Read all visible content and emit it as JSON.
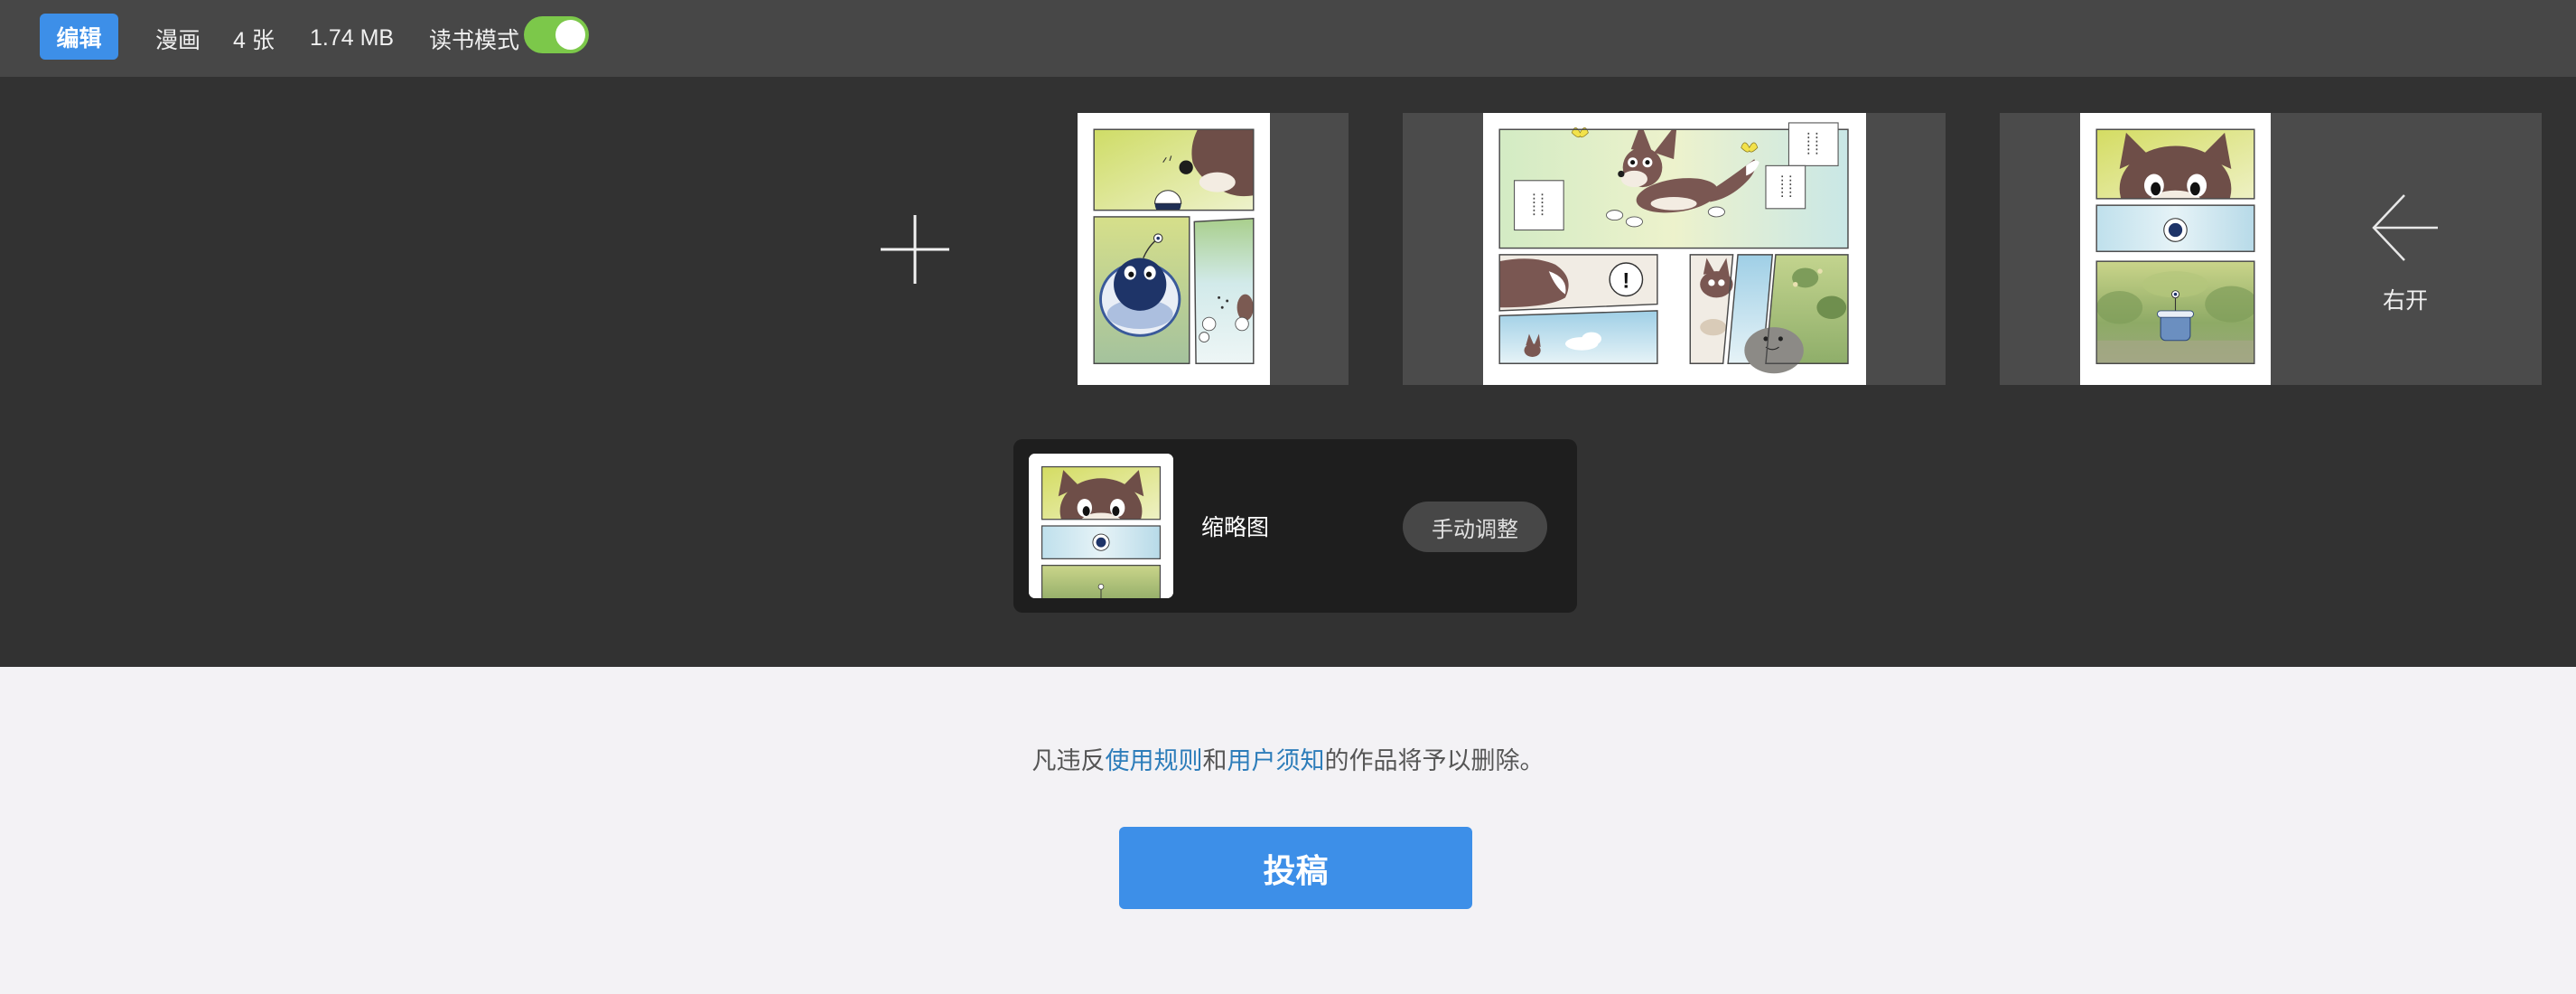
{
  "toolbar": {
    "edit_label": "编辑",
    "category": "漫画",
    "count": "4 张",
    "size": "1.74 MB",
    "reading_mode_label": "读书模式",
    "reading_mode_on": true
  },
  "icons": {
    "add": "plus-icon",
    "direction": "arrow-left-icon"
  },
  "direction": {
    "label": "右开"
  },
  "pages": [
    {
      "kind": "comic-page"
    },
    {
      "kind": "comic-spread",
      "bubble": "!"
    },
    {
      "kind": "comic-page"
    }
  ],
  "thumbnail": {
    "label": "缩略图",
    "adjust_button": "手动调整"
  },
  "notice": {
    "prefix": "凡违反",
    "link1": "使用规则",
    "middle": "和",
    "link2": "用户须知",
    "suffix": "的作品将予以删除。"
  },
  "submit_label": "投稿",
  "colors": {
    "primary": "#3d8fe8",
    "toggle_on": "#7cc84a",
    "link": "#2d7dba",
    "topbar": "#474747",
    "workspace": "#323232",
    "footer": "#f3f2f5"
  }
}
